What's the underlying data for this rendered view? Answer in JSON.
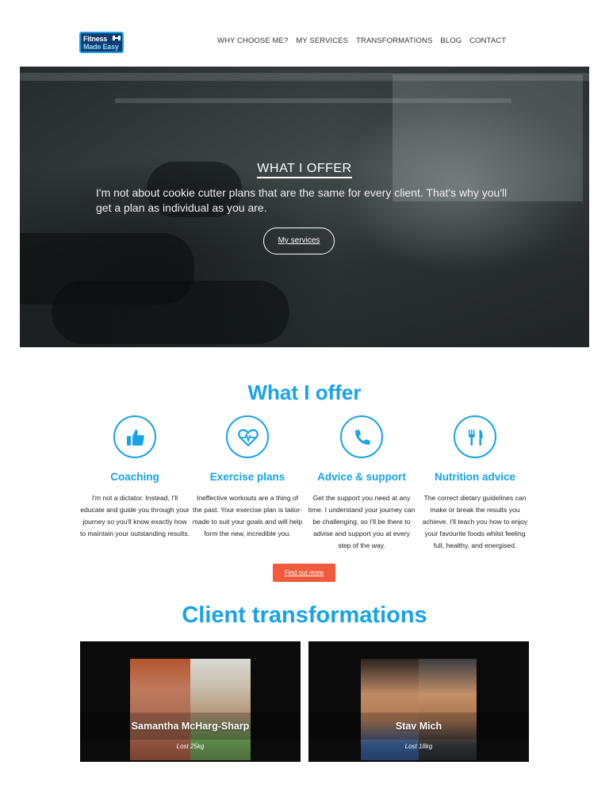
{
  "brand": {
    "logo_line1": "Fitness",
    "logo_line2": "Made Easy",
    "accent": "#17a3e8",
    "cta_color": "#f15b3c"
  },
  "nav": {
    "items": [
      "WHY CHOOSE ME?",
      "MY SERVICES",
      "TRANSFORMATIONS",
      "BLOG",
      "CONTACT"
    ]
  },
  "hero": {
    "title": "WHAT I OFFER",
    "text": "I'm not about cookie cutter plans that are the same for every client. That's why you'll get a plan as individual as you are.",
    "button": "My services"
  },
  "offer": {
    "title": "What I offer",
    "services": [
      {
        "icon": "thumbs-up-icon",
        "name": "Coaching",
        "desc": "I'm not a dictator. Instead, I'll educate and guide you through your journey so you'll know exactly how to maintain your outstanding results."
      },
      {
        "icon": "heartbeat-icon",
        "name": "Exercise plans",
        "desc": "Ineffective workouts are a thing of the past. Your exercise plan is tailor-made to suit your goals and will help form the new, incredible you."
      },
      {
        "icon": "phone-icon",
        "name": "Advice & support",
        "desc": "Get the support you need at any time. I understand your journey can be challenging, so I'll be there to advise and support you at every step of the way."
      },
      {
        "icon": "fork-knife-icon",
        "name": "Nutrition advice",
        "desc": "The correct dietary guidelines can make or break the results you achieve. I'll teach you how to enjoy your favourite foods whilst feeling full, healthy, and energised."
      }
    ],
    "cta": "Find out more"
  },
  "transformations": {
    "title": "Client transformations",
    "cards": [
      {
        "name": "Samantha McHarg-Sharp",
        "sub": "Lost 25kg"
      },
      {
        "name": "Stav Mich",
        "sub": "Lost 18kg"
      }
    ]
  }
}
